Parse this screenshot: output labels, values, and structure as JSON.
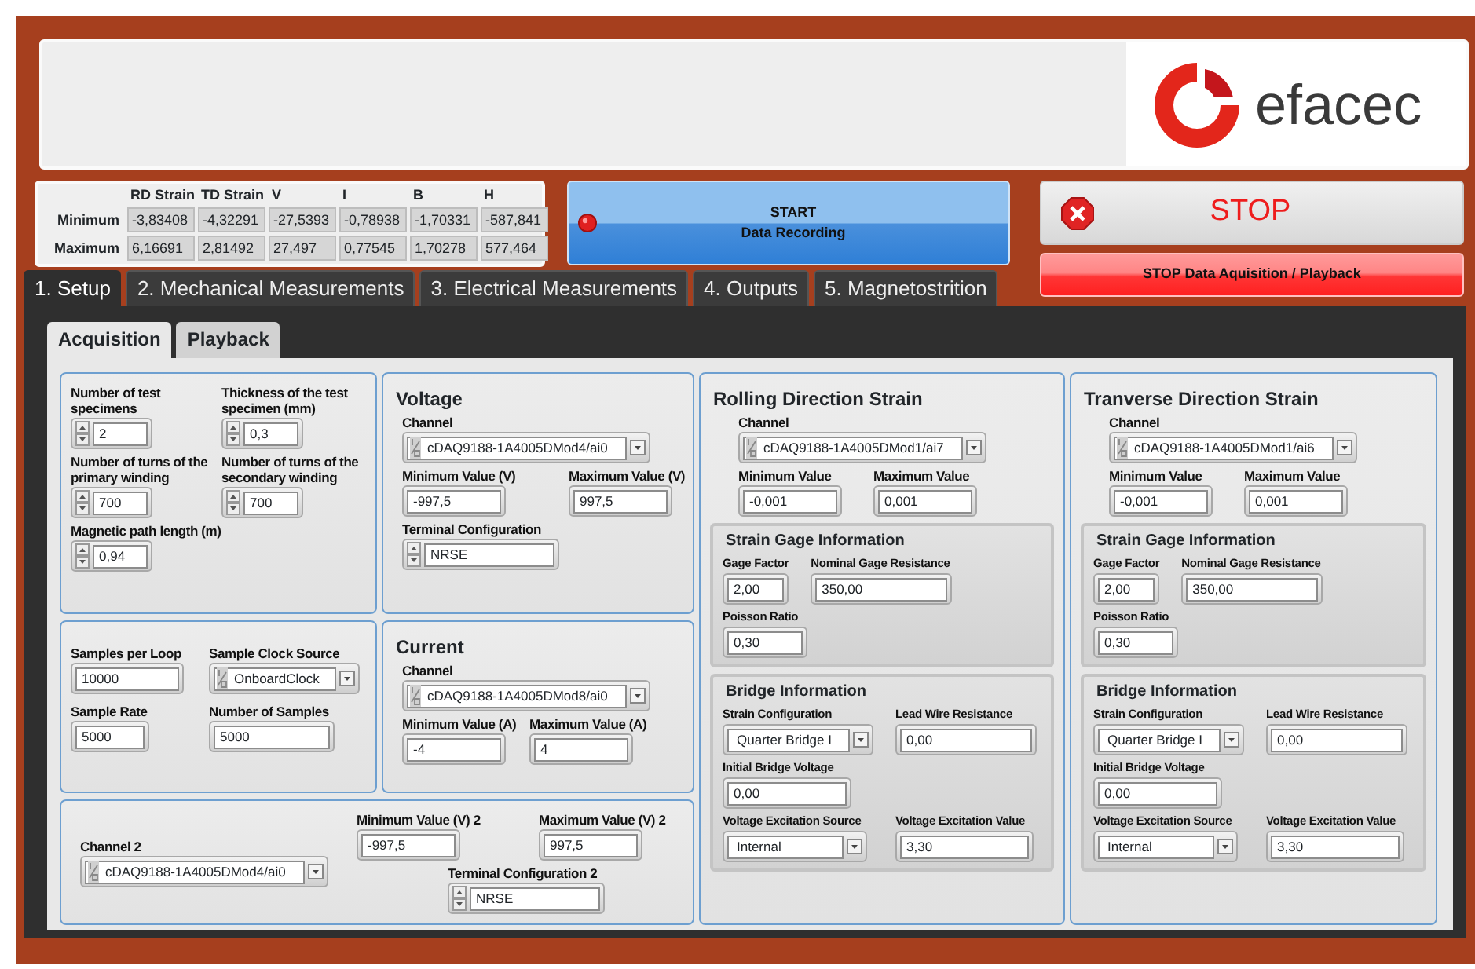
{
  "header": {
    "logo_text": "efacec"
  },
  "stats": {
    "columns": [
      "RD Strain",
      "TD Strain",
      "V",
      "I",
      "B",
      "H"
    ],
    "rows": [
      {
        "label": "Minimum",
        "values": [
          "-3,83408",
          "-4,32291",
          "-27,5393",
          "-0,78938",
          "-1,70331",
          "-587,841"
        ]
      },
      {
        "label": "Maximum",
        "values": [
          "6,16691",
          "2,81492",
          "27,497",
          "0,77545",
          "1,70278",
          "577,464"
        ]
      }
    ]
  },
  "start_button": {
    "title": "START",
    "subtitle": "Data Recording"
  },
  "stop_button": {
    "label": "STOP"
  },
  "stop_acquisition_button": {
    "label": "STOP Data Aquisition / Playback"
  },
  "tabs": [
    {
      "label": "1. Setup",
      "selected": true
    },
    {
      "label": "2. Mechanical Measurements",
      "selected": false
    },
    {
      "label": "3. Electrical Measurements",
      "selected": false
    },
    {
      "label": "4. Outputs",
      "selected": false
    },
    {
      "label": "5. Magnetostrition",
      "selected": false
    }
  ],
  "subtabs": [
    {
      "label": "Acquisition",
      "selected": true
    },
    {
      "label": "Playback",
      "selected": false
    }
  ],
  "panels": [
    {
      "controls": [
        {
          "label": "Number of test specimens",
          "value": "2",
          "kind": "numeric"
        },
        {
          "label": "Thickness of the test specimen (mm)",
          "value": "0,3",
          "kind": "numeric"
        },
        {
          "label": "Number of turns of the primary winding",
          "value": "700",
          "kind": "numeric"
        },
        {
          "label": "Number of turns of the secondary winding",
          "value": "700",
          "kind": "numeric"
        },
        {
          "label": "Magnetic path length (m)",
          "value": "0,94",
          "kind": "numeric"
        }
      ]
    },
    {
      "title": "Voltage",
      "controls": [
        {
          "label": "Channel",
          "value": "cDAQ9188-1A4005DMod4/ai0",
          "kind": "ring"
        },
        {
          "label": "Minimum Value (V)",
          "value": "-997,5",
          "kind": "text"
        },
        {
          "label": "Maximum Value (V)",
          "value": "997,5",
          "kind": "text"
        },
        {
          "label": "Terminal Configuration",
          "value": "NRSE",
          "kind": "numeric"
        }
      ]
    },
    {
      "controls": [
        {
          "label": "Samples per Loop",
          "value": "10000",
          "kind": "text"
        },
        {
          "label": "Sample Clock Source",
          "value": "OnboardClock",
          "kind": "ring"
        },
        {
          "label": "Sample Rate",
          "value": "5000",
          "kind": "text"
        },
        {
          "label": "Number of Samples",
          "value": "5000",
          "kind": "text"
        }
      ]
    },
    {
      "title": "Current",
      "controls": [
        {
          "label": "Channel",
          "value": "cDAQ9188-1A4005DMod8/ai0",
          "kind": "ring"
        },
        {
          "label": "Minimum Value (A)",
          "value": "-4",
          "kind": "text"
        },
        {
          "label": "Maximum Value (A)",
          "value": "4",
          "kind": "text"
        }
      ]
    },
    {
      "controls": [
        {
          "label": "Channel  2",
          "value": "cDAQ9188-1A4005DMod4/ai0",
          "kind": "ring"
        },
        {
          "label": "Minimum Value (V) 2",
          "value": "-997,5",
          "kind": "text"
        },
        {
          "label": "Maximum Value (V)  2",
          "value": "997,5",
          "kind": "text"
        },
        {
          "label": "Terminal Configuration  2",
          "value": "NRSE",
          "kind": "numeric"
        }
      ]
    },
    {
      "title": "Rolling Direction Strain",
      "controls": [
        {
          "label": "Channel",
          "value": "cDAQ9188-1A4005DMod1/ai7",
          "kind": "ring"
        },
        {
          "label": "Minimum Value",
          "value": "-0,001",
          "kind": "text"
        },
        {
          "label": "Maximum Value",
          "value": "0,001",
          "kind": "text"
        }
      ],
      "groups": [
        {
          "title": "Strain Gage Information",
          "controls": [
            {
              "label": "Gage Factor",
              "value": "2,00",
              "kind": "text"
            },
            {
              "label": "Nominal Gage Resistance",
              "value": "350,00",
              "kind": "text"
            },
            {
              "label": "Poisson Ratio",
              "value": "0,30",
              "kind": "text"
            }
          ]
        },
        {
          "title": "Bridge Information",
          "controls": [
            {
              "label": "Strain Configuration",
              "value": "Quarter Bridge I",
              "kind": "enum"
            },
            {
              "label": "Lead Wire Resistance",
              "value": "0,00",
              "kind": "text"
            },
            {
              "label": "Initial Bridge Voltage",
              "value": "0,00",
              "kind": "text"
            },
            {
              "label": "Voltage Excitation Source",
              "value": "Internal",
              "kind": "enum"
            },
            {
              "label": "Voltage Excitation Value",
              "value": "3,30",
              "kind": "text"
            }
          ]
        }
      ]
    },
    {
      "title": "Tranverse Direction Strain",
      "controls": [
        {
          "label": "Channel",
          "value": "cDAQ9188-1A4005DMod1/ai6",
          "kind": "ring"
        },
        {
          "label": "Minimum Value",
          "value": "-0,001",
          "kind": "text"
        },
        {
          "label": "Maximum Value",
          "value": "0,001",
          "kind": "text"
        }
      ],
      "groups": [
        {
          "title": "Strain Gage Information",
          "controls": [
            {
              "label": "Gage Factor",
              "value": "2,00",
              "kind": "text"
            },
            {
              "label": "Nominal Gage Resistance",
              "value": "350,00",
              "kind": "text"
            },
            {
              "label": "Poisson Ratio",
              "value": "0,30",
              "kind": "text"
            }
          ]
        },
        {
          "title": "Bridge Information",
          "controls": [
            {
              "label": "Strain Configuration",
              "value": "Quarter Bridge I",
              "kind": "enum"
            },
            {
              "label": "Lead Wire Resistance",
              "value": "0,00",
              "kind": "text"
            },
            {
              "label": "Initial Bridge Voltage",
              "value": "0,00",
              "kind": "text"
            },
            {
              "label": "Voltage Excitation Source",
              "value": "Internal",
              "kind": "enum"
            },
            {
              "label": "Voltage Excitation Value",
              "value": "3,30",
              "kind": "text"
            }
          ]
        }
      ]
    }
  ]
}
